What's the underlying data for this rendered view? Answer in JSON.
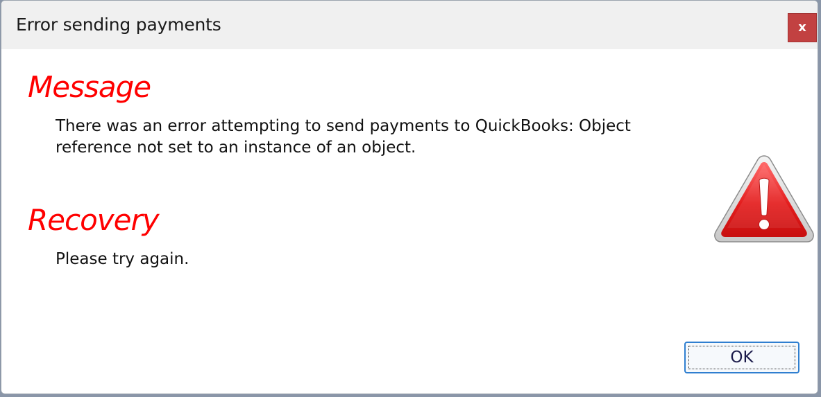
{
  "window": {
    "title": "Error sending payments",
    "close_label": "x"
  },
  "message": {
    "heading": "Message",
    "text": "There was an error attempting to send payments to QuickBooks: Object reference not set to an instance of an object."
  },
  "recovery": {
    "heading": "Recovery",
    "text": "Please try again."
  },
  "buttons": {
    "ok_label": "OK"
  },
  "icons": {
    "dialog_icon": "warning-triangle-icon",
    "close": "close-icon"
  },
  "colors": {
    "heading": "#ff0000",
    "close_button": "#c24141",
    "ok_border": "#2f7fd0",
    "warning_red": "#e02020"
  }
}
